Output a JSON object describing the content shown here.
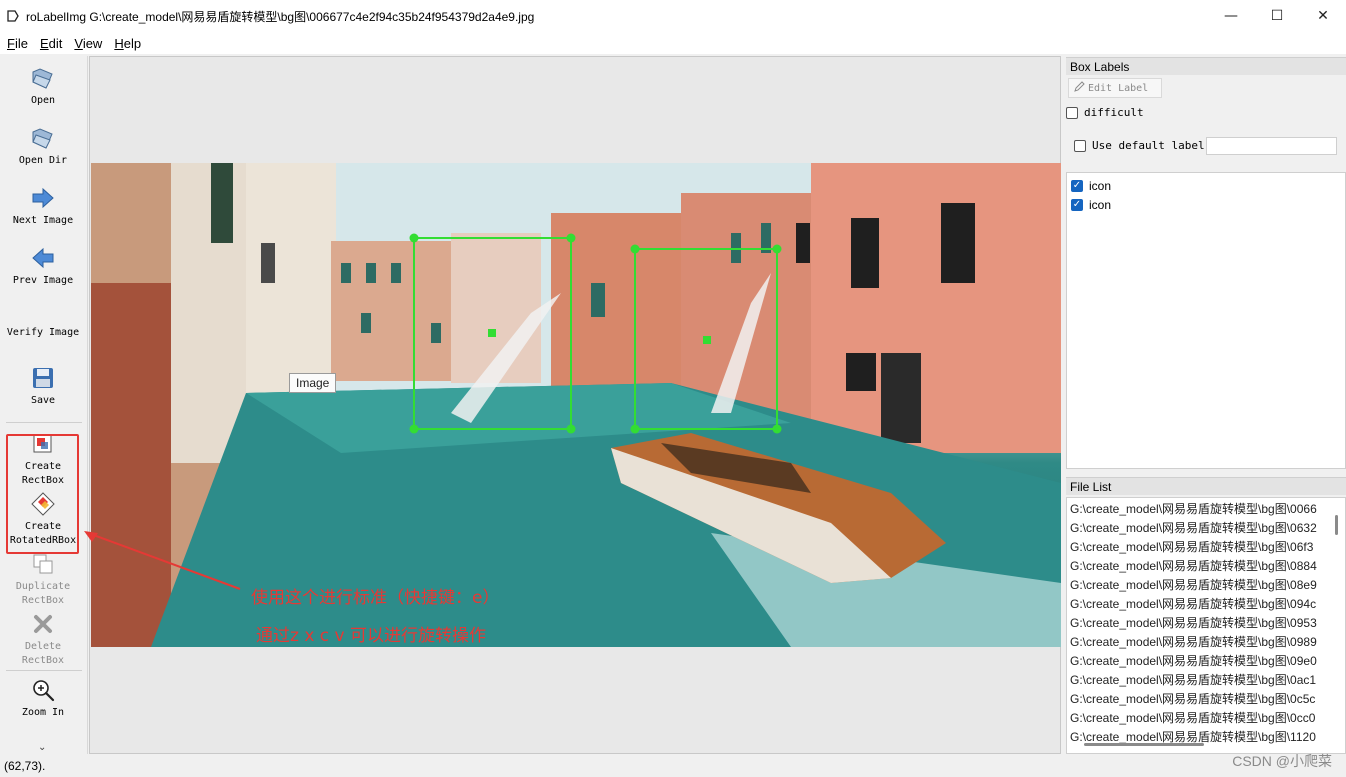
{
  "window": {
    "title": "roLabelImg G:\\create_model\\网易易盾旋转模型\\bg图\\006677c4e2f94c35b24f954379d2a4e9.jpg",
    "minimize": "—",
    "maximize": "☐",
    "close": "✕"
  },
  "menu": [
    {
      "key": "F",
      "rest": "ile"
    },
    {
      "key": "E",
      "rest": "dit"
    },
    {
      "key": "V",
      "rest": "iew"
    },
    {
      "key": "H",
      "rest": "elp"
    }
  ],
  "toolbar": {
    "open": "Open",
    "open_dir": "Open Dir",
    "next_image": "Next Image",
    "prev_image": "Prev Image",
    "verify_image": "Verify Image",
    "save": "Save",
    "create_rectbox_1": "Create",
    "create_rectbox_2": "RectBox",
    "create_rotated_1": "Create",
    "create_rotated_2": "RotatedRBox",
    "duplicate_1": "Duplicate",
    "duplicate_2": "RectBox",
    "delete_1": "Delete",
    "delete_2": "RectBox",
    "zoom_in": "Zoom In",
    "more": "⌄"
  },
  "canvas": {
    "tooltip": "Image",
    "annotation_line1": "使用这个进行标准（快捷键：e）",
    "annotation_line2": "通过z x c v 可以进行旋转操作"
  },
  "box_labels": {
    "title": "Box Labels",
    "edit_label": "Edit Label",
    "difficult": "difficult",
    "use_default_label": "Use default label",
    "default_label_value": "",
    "labels": [
      {
        "text": "icon",
        "checked": true
      },
      {
        "text": "icon",
        "checked": true
      }
    ]
  },
  "file_list": {
    "title": "File List",
    "files": [
      "G:\\create_model\\网易易盾旋转模型\\bg图\\0066",
      "G:\\create_model\\网易易盾旋转模型\\bg图\\0632",
      "G:\\create_model\\网易易盾旋转模型\\bg图\\06f3",
      "G:\\create_model\\网易易盾旋转模型\\bg图\\0884",
      "G:\\create_model\\网易易盾旋转模型\\bg图\\08e9",
      "G:\\create_model\\网易易盾旋转模型\\bg图\\094c",
      "G:\\create_model\\网易易盾旋转模型\\bg图\\0953",
      "G:\\create_model\\网易易盾旋转模型\\bg图\\0989",
      "G:\\create_model\\网易易盾旋转模型\\bg图\\09e0",
      "G:\\create_model\\网易易盾旋转模型\\bg图\\0ac1",
      "G:\\create_model\\网易易盾旋转模型\\bg图\\0c5c",
      "G:\\create_model\\网易易盾旋转模型\\bg图\\0cc0",
      "G:\\create_model\\网易易盾旋转模型\\bg图\\1120"
    ]
  },
  "status": {
    "coords": "(62,73).",
    "watermark": "CSDN @小爬菜"
  },
  "colors": {
    "accent": "#1565c0",
    "annotation": "#e53935",
    "bbox": "#33dd33"
  }
}
